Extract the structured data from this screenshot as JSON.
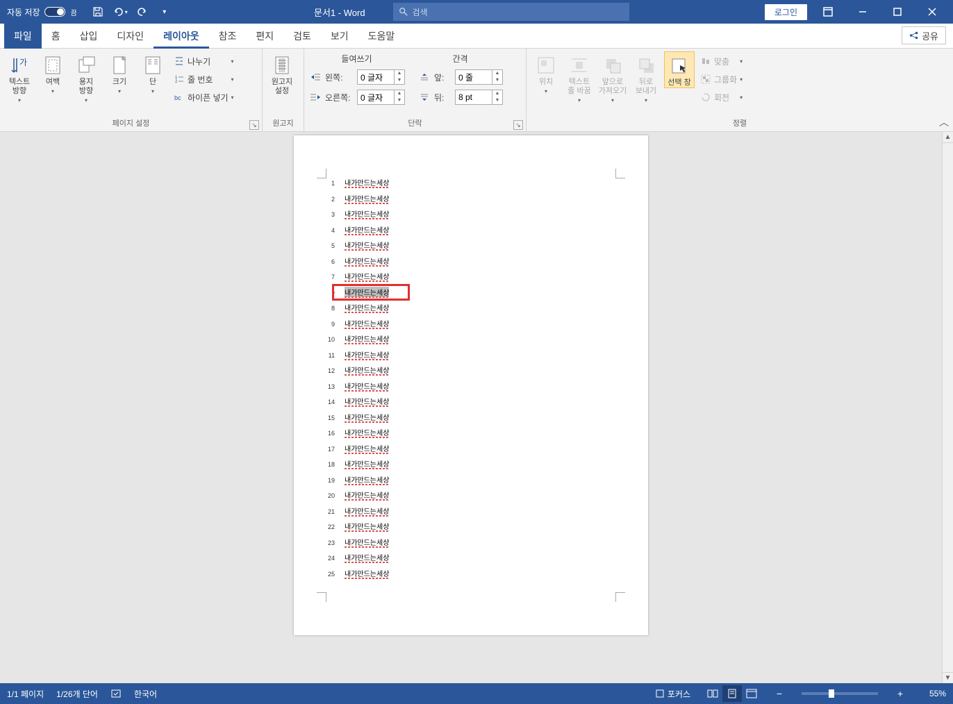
{
  "titlebar": {
    "autosave_label": "자동 저장",
    "autosave_state": "끔",
    "doc_title": "문서1  -  Word",
    "search_placeholder": "검색",
    "login": "로그인"
  },
  "tabs": {
    "file": "파일",
    "items": [
      "홈",
      "삽입",
      "디자인",
      "레이아웃",
      "참조",
      "편지",
      "검토",
      "보기",
      "도움말"
    ],
    "active": "레이아웃",
    "share": "공유"
  },
  "ribbon": {
    "page_setup": {
      "label": "페이지 설정",
      "text_direction": "텍스트\n방향",
      "margins": "여백",
      "paper_direction": "용지\n방향",
      "size": "크기",
      "columns": "단",
      "breaks": "나누기",
      "line_numbers": "줄 번호",
      "hyphenation": "하이픈 넣기"
    },
    "manuscript": {
      "label": "원고지",
      "btn": "원고지\n설정"
    },
    "paragraph": {
      "label": "단락",
      "indent_header": "들여쓰기",
      "spacing_header": "간격",
      "left_label": "왼쪽:",
      "right_label": "오른쪽:",
      "before_label": "앞:",
      "after_label": "뒤:",
      "left_val": "0 글자",
      "right_val": "0 글자",
      "before_val": "0 줄",
      "after_val": "8 pt"
    },
    "arrange": {
      "label": "정렬",
      "position": "위치",
      "wrap": "텍스트\n줄 바꿈",
      "bring_forward": "앞으로\n가져오기",
      "send_backward": "뒤로\n보내기",
      "selection_pane": "선택 창",
      "align": "맞춤",
      "group": "그룹화",
      "rotate": "회전"
    }
  },
  "document": {
    "line_text": "내가만드는세상",
    "highlighted_index": 7,
    "total_numbered": 25
  },
  "statusbar": {
    "page": "1/1 페이지",
    "words": "1/26개 단어",
    "language": "한국어",
    "focus": "포커스",
    "zoom": "55%"
  }
}
